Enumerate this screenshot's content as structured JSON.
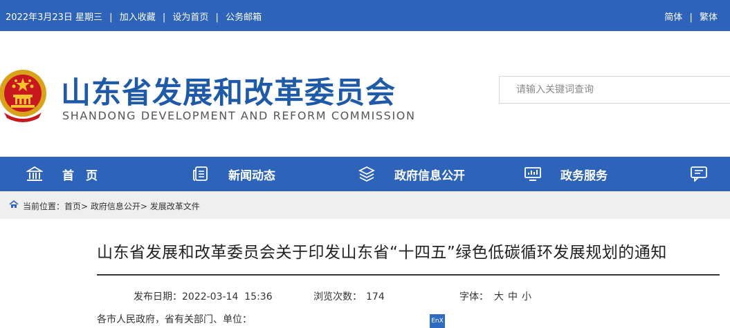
{
  "topbar": {
    "date": "2022年3月23日 星期三",
    "links": [
      "加入收藏",
      "设为首页",
      "公务邮箱"
    ],
    "lang_simplified": "简体",
    "lang_traditional": "繁体"
  },
  "header": {
    "title_cn": "山东省发展和改革委员会",
    "title_en": "SHANDONG DEVELOPMENT AND REFORM COMMISSION",
    "search_placeholder": "请输入关键词查询"
  },
  "nav": {
    "items": [
      {
        "label": "首　页",
        "icon": "building-icon"
      },
      {
        "label": "新闻动态",
        "icon": "document-icon"
      },
      {
        "label": "政府信息公开",
        "icon": "layers-icon"
      },
      {
        "label": "政务服务",
        "icon": "monitor-icon"
      },
      {
        "label": "",
        "icon": "message-icon"
      }
    ]
  },
  "breadcrumb": {
    "prefix": "当前位置：",
    "items": [
      "首页",
      "政府信息公开",
      "发展改革文件"
    ]
  },
  "article": {
    "title": "山东省发展和改革委员会关于印发山东省“十四五”绿色低碳循环发展规划的通知",
    "publish_label": "发布日期：",
    "publish_date": "2022-03-14  15:36",
    "views_label": "浏览次数：",
    "views": "174",
    "font_label": "字体：",
    "font_sizes": [
      "大",
      "中",
      "小"
    ],
    "body_first_line": "各市人民政府，省有关部门、单位：",
    "translate_badge": "EnX"
  },
  "colors": {
    "primary": "#2d63b8",
    "title": "#1e5aa8",
    "breadcrumb_bg": "#efefef"
  }
}
